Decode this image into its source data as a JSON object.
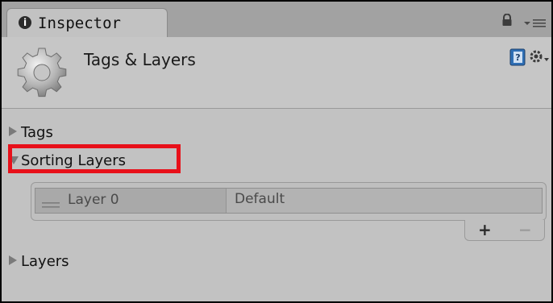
{
  "window": {
    "tab_title": "Inspector",
    "tab_icon": "info-icon",
    "lock_icon": "lock-icon",
    "menu_icon": "panel-menu-icon"
  },
  "header": {
    "title": "Tags & Layers",
    "icon": "gear-icon",
    "help_icon": "help-book-icon",
    "settings_icon": "settings-gear-icon"
  },
  "sections": {
    "tags": {
      "label": "Tags",
      "expanded": false
    },
    "sorting_layers": {
      "label": "Sorting Layers",
      "expanded": true,
      "rows": [
        {
          "name": "Layer 0",
          "value": "Default"
        }
      ],
      "add_label": "+",
      "remove_label": "−"
    },
    "layers": {
      "label": "Layers",
      "expanded": false
    }
  },
  "colors": {
    "highlight": "#e8101a",
    "panel_bg": "#c2c2c2",
    "tab_bar_bg": "#a2a2a2"
  }
}
